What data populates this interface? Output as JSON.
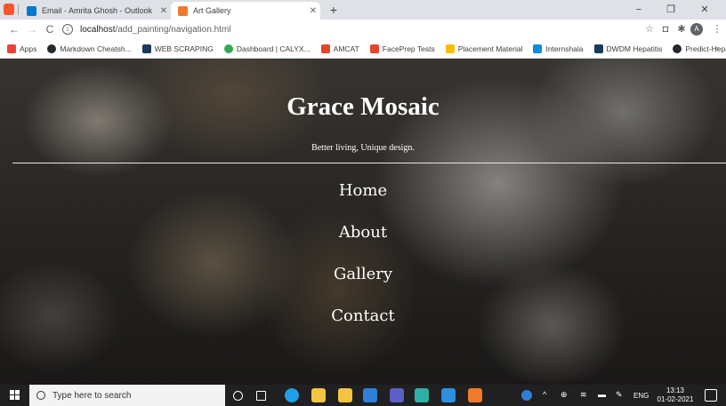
{
  "browser": {
    "tabs": [
      {
        "title": "Email - Amrita Ghosh - Outlook",
        "active": false,
        "favicon_color": "#0078d4"
      },
      {
        "title": "Art Gallery",
        "active": true,
        "favicon_color": "#f07a2b"
      }
    ],
    "new_tab": "+",
    "window_controls": {
      "minimize": "−",
      "restore": "❐",
      "close": "✕"
    },
    "nav": {
      "back": "←",
      "forward": "→",
      "reload": "C"
    },
    "address": {
      "host": "localhost",
      "path": "/add_painting/navigation.html"
    },
    "profile_initial": "A",
    "bookmarks": [
      {
        "label": "Apps",
        "color": "#ea4335"
      },
      {
        "label": "Markdown Cheatsh...",
        "color": "#24292e"
      },
      {
        "label": "WEB SCRAPING",
        "color": "#1a3a5c"
      },
      {
        "label": "Dashboard | CALYX...",
        "color": "#34a853"
      },
      {
        "label": "AMCAT",
        "color": "#e8432c"
      },
      {
        "label": "FacePrep Tests",
        "color": "#e8432c"
      },
      {
        "label": "Placement Material",
        "color": "#fbbc04"
      },
      {
        "label": "Internshala",
        "color": "#0a8ed9"
      },
      {
        "label": "DWDM Hepatitis",
        "color": "#1a3a5c"
      },
      {
        "label": "Predict-Hepatitis co...",
        "color": "#24292e"
      }
    ],
    "bookmarks_more": "»"
  },
  "site": {
    "title": "Grace Mosaic",
    "tagline": "Better living, Unique design.",
    "nav": [
      "Home",
      "About",
      "Gallery",
      "Contact"
    ]
  },
  "taskbar": {
    "search_placeholder": "Type here to search",
    "time": "13:13",
    "date": "01-02-2021",
    "language": "ENG",
    "apps": [
      {
        "name": "cortana-icon",
        "color": "#202020"
      },
      {
        "name": "task-view-icon",
        "color": "#202020"
      },
      {
        "name": "edge-icon",
        "color": "#1fa0e6"
      },
      {
        "name": "file-explorer-icon",
        "color": "#f4c542"
      },
      {
        "name": "store-icon",
        "color": "#f4c542"
      },
      {
        "name": "mail-icon",
        "color": "#2f7fd8"
      },
      {
        "name": "teams-icon",
        "color": "#5b5fc7"
      },
      {
        "name": "brave-icon",
        "color": "#2fb0a6"
      },
      {
        "name": "vscode-icon",
        "color": "#2d8fe0"
      },
      {
        "name": "brave-browser-icon",
        "color": "#f07a2b"
      }
    ]
  }
}
